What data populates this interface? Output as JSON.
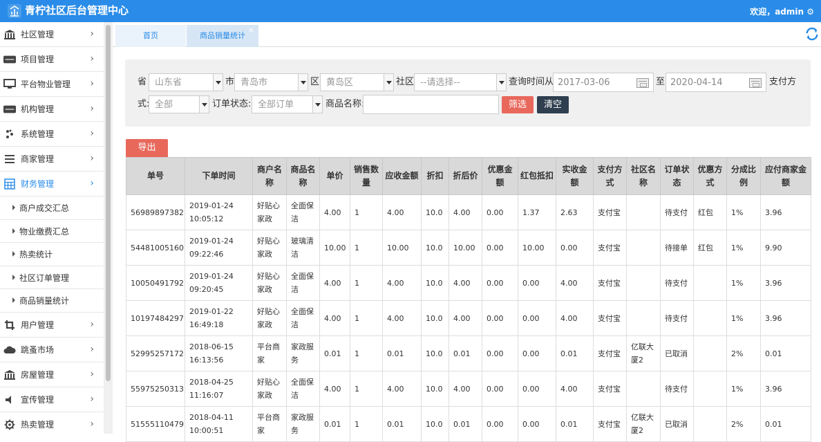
{
  "header": {
    "app_title": "青柠社区后台管理中心",
    "welcome": "欢迎，admin ⚙"
  },
  "sidebar": {
    "items": [
      {
        "label": "社区管理",
        "icon": "bank-icon"
      },
      {
        "label": "项目管理",
        "icon": "discover-card-icon"
      },
      {
        "label": "平台物业管理",
        "icon": "monitor-icon"
      },
      {
        "label": "机构管理",
        "icon": "stripe-icon"
      },
      {
        "label": "系统管理",
        "icon": "slack-icon"
      },
      {
        "label": "商家管理",
        "icon": "menu-lines-icon"
      },
      {
        "label": "财务管理",
        "icon": "calculator-icon",
        "active": true
      }
    ],
    "sub_items": [
      "商户成交汇总",
      "物业缴费汇总",
      "热卖统计",
      "社区订单管理",
      "商品销量统计"
    ],
    "items_after": [
      {
        "label": "用户管理",
        "icon": "crop-icon"
      },
      {
        "label": "跳蚤市场",
        "icon": "cloud-icon"
      },
      {
        "label": "房屋管理",
        "icon": "bank-icon"
      },
      {
        "label": "宣传管理",
        "icon": "volume-icon"
      },
      {
        "label": "热卖管理",
        "icon": "gear-icon"
      }
    ],
    "chevron": "›"
  },
  "tabs": {
    "home": "首页",
    "current": "商品销量统计",
    "close": "×"
  },
  "filter": {
    "province_label": "省",
    "province_value": "山东省",
    "city_label": "市",
    "city_value": "青岛市",
    "district_label": "区",
    "district_value": "黄岛区",
    "community_label": "社区",
    "community_value": "--请选择--",
    "time_label": "查询时间从",
    "date_from": "2017-03-06",
    "to_label": "至",
    "date_to": "2020-04-14",
    "pay_label_1": "支付方",
    "pay_label_2": "式:",
    "pay_value": "全部",
    "order_status_label": "订单状态:",
    "order_status_value": "全部订单",
    "product_label": "商品名称:",
    "filter_button": "筛选",
    "clear_button": "清空"
  },
  "export_button": "导出",
  "table": {
    "headers": [
      "单号",
      "下单时间",
      "商户名称",
      "商品名称",
      "单价",
      "销售数量",
      "应收金额",
      "折扣",
      "折后价",
      "优惠金额",
      "红包抵扣",
      "实收金额",
      "支付方式",
      "社区名称",
      "订单状态",
      "优惠方式",
      "分成比例",
      "应付商家金额"
    ],
    "rows": [
      [
        "56989897382",
        "2019-01-24 10:05:12",
        "好贴心家政",
        "全面保洁",
        "4.00",
        "1",
        "4.00",
        "10.0",
        "4.00",
        "0.00",
        "1.37",
        "2.63",
        "支付宝",
        "",
        "待支付",
        "红包",
        "1%",
        "3.96"
      ],
      [
        "54481005160",
        "2019-01-24 09:22:46",
        "好贴心家政",
        "玻璃清洁",
        "10.00",
        "1",
        "10.00",
        "10.0",
        "10.00",
        "0.00",
        "10.00",
        "0.00",
        "支付宝",
        "",
        "待接单",
        "红包",
        "1%",
        "9.90"
      ],
      [
        "10050491792",
        "2019-01-24 09:20:45",
        "好贴心家政",
        "全面保洁",
        "4.00",
        "1",
        "4.00",
        "10.0",
        "4.00",
        "0.00",
        "0.00",
        "4.00",
        "支付宝",
        "",
        "待支付",
        "",
        "1%",
        "3.96"
      ],
      [
        "10197484297",
        "2019-01-22 16:49:18",
        "好贴心家政",
        "全面保洁",
        "4.00",
        "1",
        "4.00",
        "10.0",
        "4.00",
        "0.00",
        "0.00",
        "4.00",
        "支付宝",
        "",
        "待支付",
        "",
        "1%",
        "3.96"
      ],
      [
        "52995257172",
        "2018-06-15 16:13:56",
        "平台商家",
        "家政服务",
        "0.01",
        "1",
        "0.01",
        "10.0",
        "0.01",
        "0.00",
        "0.00",
        "0.01",
        "支付宝",
        "亿联大厦2",
        "已取消",
        "",
        "2%",
        "0.01"
      ],
      [
        "55975250313",
        "2018-04-25 11:16:07",
        "好贴心家政",
        "全面保洁",
        "4.00",
        "1",
        "4.00",
        "10.0",
        "4.00",
        "0.00",
        "0.00",
        "4.00",
        "支付宝",
        "",
        "待支付",
        "",
        "1%",
        "3.96"
      ],
      [
        "51555110479",
        "2018-04-11 10:00:51",
        "平台商家",
        "家政服务",
        "0.01",
        "1",
        "0.01",
        "10.0",
        "0.01",
        "0.00",
        "0.00",
        "0.01",
        "支付宝",
        "亿联大厦2",
        "已取消",
        "",
        "2%",
        "0.01"
      ]
    ]
  },
  "colors": {
    "brand": "#2a8ce8",
    "danger": "#e8685c",
    "dark": "#2f3f4f"
  }
}
